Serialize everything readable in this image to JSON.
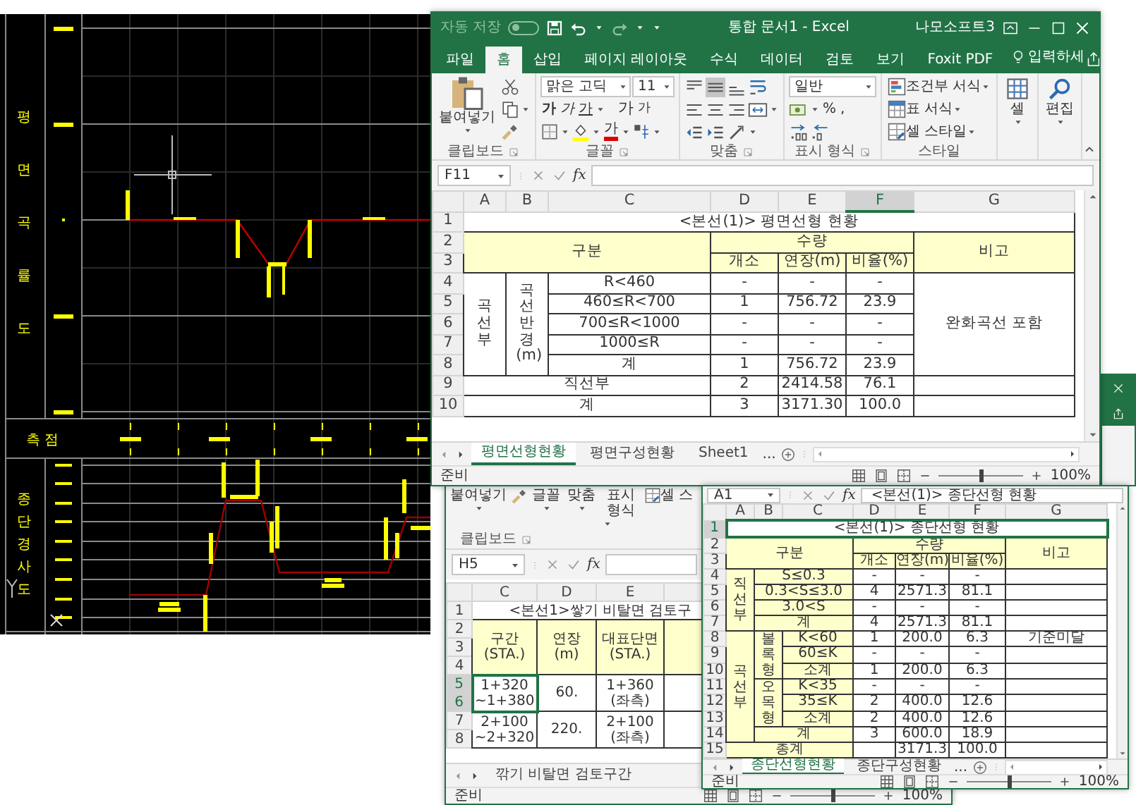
{
  "cad": {
    "plan_labels": [
      "평",
      "면",
      "곡",
      "률",
      "도"
    ],
    "station_label": "측 점",
    "profile_labels": [
      "종",
      "단",
      "경",
      "사",
      "도"
    ]
  },
  "main_window": {
    "title_bar": {
      "autosave": "자동 저장",
      "autosave_on": false,
      "document": "통합 문서1  -  Excel",
      "user": "나모소프트3"
    },
    "tabs": [
      {
        "label": "파일",
        "selected": false
      },
      {
        "label": "홈",
        "selected": true
      },
      {
        "label": "삽입",
        "selected": false
      },
      {
        "label": "페이지 레이아웃",
        "selected": false
      },
      {
        "label": "수식",
        "selected": false
      },
      {
        "label": "데이터",
        "selected": false
      },
      {
        "label": "검토",
        "selected": false
      },
      {
        "label": "보기",
        "selected": false
      },
      {
        "label": "Foxit PDF",
        "selected": false
      }
    ],
    "tell_me": "입력하세",
    "ribbon": {
      "paste": "붙여넣기",
      "font_name": "맑은 고딕",
      "font_size": "11",
      "font_buttons": [
        {
          "label": "가",
          "kind": "bold"
        },
        {
          "label": "가",
          "kind": "italic"
        },
        {
          "label": "가",
          "kind": "underline"
        },
        {
          "label": "가",
          "kind": "grow"
        },
        {
          "label": "가",
          "kind": "shrink"
        }
      ],
      "font_color": "가",
      "number_format": "일반",
      "percent": "%",
      "comma": ",",
      "styles": [
        "조건부 서식",
        "표 서식",
        "셀 스타일"
      ],
      "cells": "셀",
      "editing": "편집",
      "groups": [
        "클립보드",
        "글꼴",
        "맞춤",
        "표시 형식",
        "스타일"
      ]
    },
    "name_box": "F11",
    "formula_label": "fx",
    "columns": [
      {
        "label": "A",
        "selected": false
      },
      {
        "label": "B",
        "selected": false
      },
      {
        "label": "C",
        "selected": false
      },
      {
        "label": "D",
        "selected": false
      },
      {
        "label": "E",
        "selected": false
      },
      {
        "label": "F",
        "selected": true
      },
      {
        "label": "G",
        "selected": false
      }
    ],
    "rows": [
      {
        "number": "1",
        "cells": [
          {
            "text": "<본선(1)> 평면선형 현황",
            "colspan": 7
          }
        ]
      },
      {
        "number": "2",
        "cells": [
          {
            "text": "구분",
            "colspan": 3,
            "rowspan": 2
          },
          {
            "text": "수량",
            "colspan": 3
          },
          {
            "text": "비고",
            "rowspan": 2
          }
        ]
      },
      {
        "number": "3",
        "cells": [
          "개소",
          "연장(m)",
          "비율(%)"
        ]
      },
      {
        "number": "4",
        "cells": [
          {
            "text": "곡선부",
            "rowspan": 5
          },
          {
            "text": "곡선반경(m)",
            "rowspan": 5
          },
          "R<460",
          "-",
          "-",
          "-",
          {
            "text": "완화곡선 포함",
            "rowspan": 5
          }
        ]
      },
      {
        "number": "5",
        "cells": [
          "460≤R<700",
          "1",
          "756.72",
          "23.9"
        ]
      },
      {
        "number": "6",
        "cells": [
          "700≤R<1000",
          "-",
          "-",
          "-"
        ]
      },
      {
        "number": "7",
        "cells": [
          "1000≤R",
          "-",
          "-",
          "-"
        ]
      },
      {
        "number": "8",
        "cells": [
          "계",
          "1",
          "756.72",
          "23.9"
        ]
      },
      {
        "number": "9",
        "cells": [
          {
            "text": "직선부",
            "colspan": 3
          },
          "2",
          "2414.58",
          "76.1"
        ]
      },
      {
        "number": "10",
        "cells": [
          {
            "text": "계",
            "colspan": 3
          },
          "3",
          "3171.30",
          "100.0"
        ]
      }
    ],
    "sheet_tabs": [
      {
        "label": "평면선형현황",
        "selected": true
      },
      {
        "label": "평면구성현황",
        "selected": false
      },
      {
        "label": "Sheet1",
        "selected": false
      }
    ],
    "more_sheets": "...",
    "status": "준비",
    "zoom": "100%",
    "zoom_slider": {
      "level": 0.5
    }
  },
  "left_window": {
    "ribbon": {
      "paste": "붙여넣기",
      "buttons": [
        "글꼴",
        "맞춤",
        "표시 형식"
      ],
      "styles": "셀 스",
      "groups": [
        "클립보드"
      ]
    },
    "name_box": "H5",
    "formula_label": "fx",
    "columns": [
      {
        "label": "C",
        "selected": false
      },
      {
        "label": "D",
        "selected": false
      },
      {
        "label": "E",
        "selected": false
      }
    ],
    "rows": [
      {
        "number": "1",
        "selected": false,
        "cells": [
          {
            "text": "<본선1>쌓기 비탈면 검토구",
            "colspan": 4
          }
        ]
      },
      {
        "number": "2",
        "selected": false,
        "cells": [
          {
            "text": "구간\n(STA.)",
            "rowspan": 3
          },
          {
            "text": "연장\n(m)",
            "rowspan": 3
          },
          {
            "text": "대표단면\n(STA.)",
            "rowspan": 3
          }
        ]
      },
      {
        "number": "3",
        "selected": false
      },
      {
        "number": "4",
        "selected": false
      },
      {
        "number": "5",
        "selected": true,
        "cells": [
          {
            "text": "1+320\n~1+380",
            "rowspan": 2
          },
          {
            "text": "60.",
            "rowspan": 2
          },
          {
            "text": "1+360\n(좌측)",
            "rowspan": 2
          }
        ]
      },
      {
        "number": "6",
        "selected": true
      },
      {
        "number": "7",
        "selected": false,
        "cells": [
          {
            "text": "2+100\n~2+320",
            "rowspan": 2
          },
          {
            "text": "220.",
            "rowspan": 2
          },
          {
            "text": "2+100\n(좌측)",
            "rowspan": 2
          }
        ]
      },
      {
        "number": "8",
        "selected": false
      }
    ],
    "sheet_tabs": [
      {
        "label": "깎기 비탈면 검토구간",
        "selected": false
      }
    ],
    "status": "준비",
    "zoom": "100%",
    "zoom_slider": {
      "level": 0.5
    }
  },
  "right_window": {
    "name_box": "A1",
    "formula_label": "fx",
    "formula": "<본선(1)> 종단선형 현황",
    "columns": [
      {
        "label": "A",
        "selected": false
      },
      {
        "label": "B",
        "selected": false
      },
      {
        "label": "C",
        "selected": false
      },
      {
        "label": "D",
        "selected": false
      },
      {
        "label": "E",
        "selected": false
      },
      {
        "label": "F",
        "selected": false
      },
      {
        "label": "G",
        "selected": false
      }
    ],
    "rows": [
      {
        "number": "1",
        "selected": true,
        "cells": [
          {
            "text": "<본선(1)> 종단선형 현황",
            "colspan": 7
          }
        ]
      },
      {
        "number": "2",
        "selected": false,
        "cells": [
          {
            "text": "구분",
            "colspan": 3,
            "rowspan": 2
          },
          {
            "text": "수량",
            "colspan": 3
          },
          {
            "text": "비고",
            "rowspan": 2
          }
        ]
      },
      {
        "number": "3",
        "selected": false,
        "cells": [
          "개소",
          "연장(m)",
          "비율(%)"
        ]
      },
      {
        "number": "4",
        "selected": false,
        "cells": [
          {
            "text": "직선부",
            "rowspan": 4
          },
          {
            "text": "S≤0.3",
            "colspan": 2
          },
          "-",
          "-",
          "-"
        ]
      },
      {
        "number": "5",
        "selected": false,
        "cells": [
          {
            "text": "0.3<S≤3.0",
            "colspan": 2
          },
          "4",
          "2571.3",
          "81.1"
        ]
      },
      {
        "number": "6",
        "selected": false,
        "cells": [
          {
            "text": "3.0<S",
            "colspan": 2
          },
          "-",
          "-",
          "-"
        ]
      },
      {
        "number": "7",
        "selected": false,
        "cells": [
          {
            "text": "계",
            "colspan": 2
          },
          "4",
          "2571.3",
          "81.1"
        ]
      },
      {
        "number": "8",
        "selected": false,
        "cells": [
          {
            "text": "곡선부",
            "rowspan": 7
          },
          {
            "text": "볼록형",
            "rowspan": 3
          },
          "K<60",
          "1",
          "200.0",
          "6.3",
          "기준미달"
        ]
      },
      {
        "number": "9",
        "selected": false,
        "cells": [
          "60≤K",
          "-",
          "-",
          "-"
        ]
      },
      {
        "number": "10",
        "selected": false,
        "cells": [
          "소계",
          "1",
          "200.0",
          "6.3"
        ]
      },
      {
        "number": "11",
        "selected": false,
        "cells": [
          {
            "text": "오목형",
            "rowspan": 3
          },
          "K<35",
          "-",
          "-",
          "-"
        ]
      },
      {
        "number": "12",
        "selected": false,
        "cells": [
          "35≤K",
          "2",
          "400.0",
          "12.6"
        ]
      },
      {
        "number": "13",
        "selected": false,
        "cells": [
          "소계",
          "2",
          "400.0",
          "12.6"
        ]
      },
      {
        "number": "14",
        "selected": false,
        "cells": [
          {
            "text": "계",
            "colspan": 2
          },
          "3",
          "600.0",
          "18.9"
        ]
      },
      {
        "number": "15",
        "selected": false,
        "cells": [
          {
            "text": "총계",
            "colspan": 3
          },
          "",
          "3171.3",
          "100.0"
        ]
      }
    ],
    "sheet_tabs": [
      {
        "label": "종단선형현황",
        "selected": true
      },
      {
        "label": "종단구성현황",
        "selected": false
      }
    ],
    "more_sheets": "...",
    "status": "준비",
    "zoom": "100%",
    "zoom_slider": {
      "level": 0.5
    }
  }
}
